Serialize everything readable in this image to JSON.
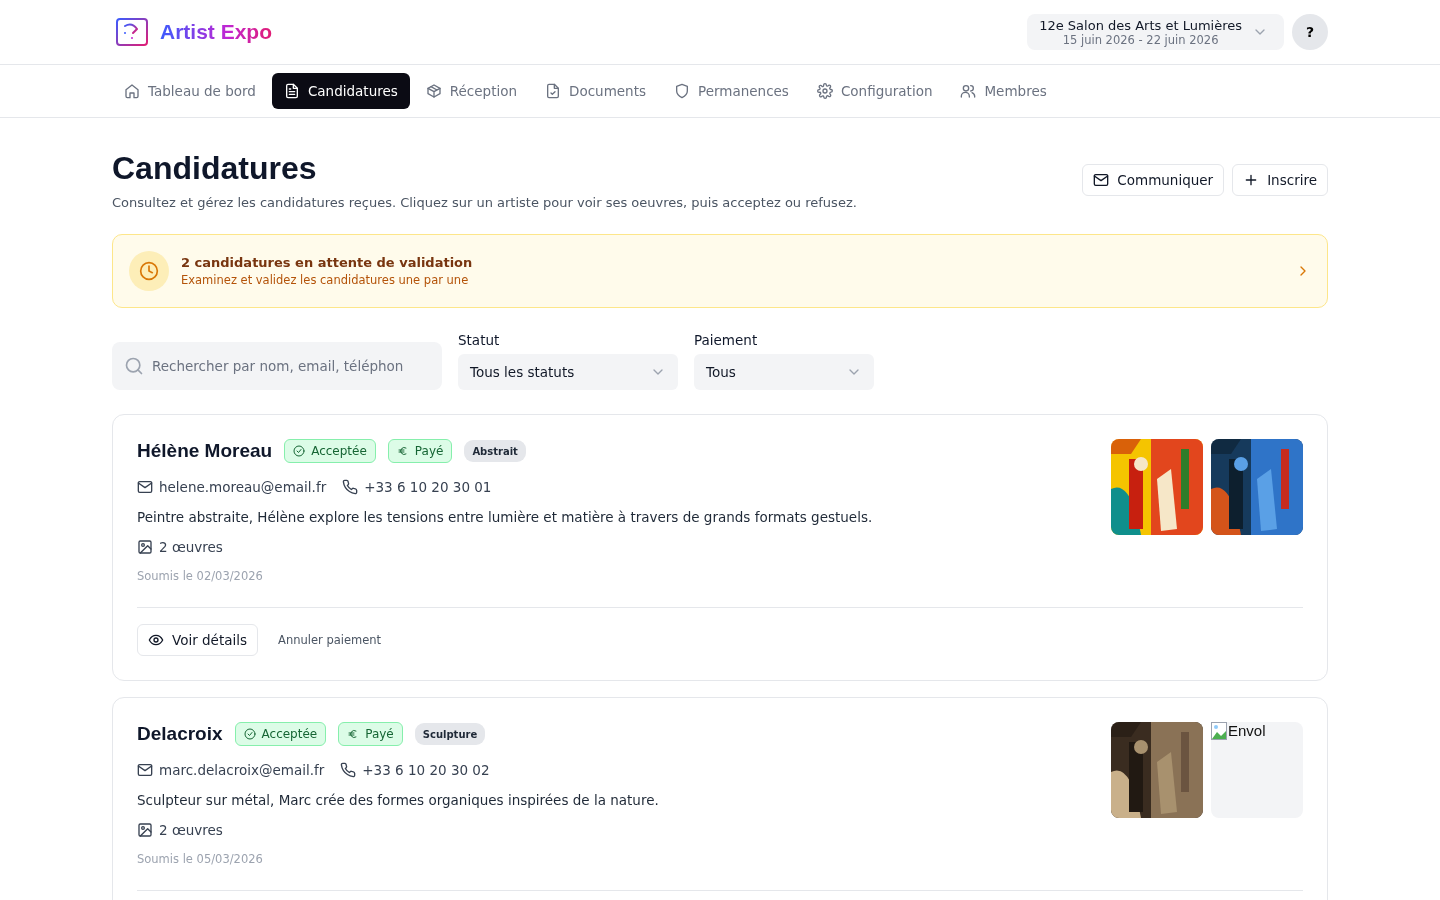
{
  "header": {
    "logo_text": "Artist Expo",
    "event": {
      "title": "12e Salon des Arts et Lumières",
      "dates": "15 juin 2026 - 22 juin 2026"
    },
    "help": "?"
  },
  "nav": [
    {
      "label": "Tableau de bord",
      "selected": false
    },
    {
      "label": "Candidatures",
      "selected": true
    },
    {
      "label": "Réception",
      "selected": false
    },
    {
      "label": "Documents",
      "selected": false
    },
    {
      "label": "Permanences",
      "selected": false
    },
    {
      "label": "Configuration",
      "selected": false
    },
    {
      "label": "Membres",
      "selected": false
    }
  ],
  "page": {
    "title": "Candidatures",
    "subtitle": "Consultez et gérez les candidatures reçues. Cliquez sur un artiste pour voir ses oeuvres, puis acceptez ou refusez.",
    "actions": [
      "Communiquer",
      "Inscrire"
    ]
  },
  "banner": {
    "title": "2 candidatures en attente de validation",
    "text": "Examinez et validez les candidatures une par une"
  },
  "filters": {
    "search": {
      "placeholder": "Rechercher par nom, email, téléphon"
    },
    "status": {
      "label": "Statut",
      "value": "Tous les statuts"
    },
    "payment": {
      "label": "Paiement",
      "value": "Tous"
    }
  },
  "applications": [
    {
      "name": "Hélène Moreau",
      "badges": [
        {
          "kind": "status",
          "label": "Acceptée"
        },
        {
          "kind": "payment",
          "label": "Payé"
        },
        {
          "kind": "category",
          "label": "Abstrait"
        }
      ],
      "email": "helene.moreau@email.fr",
      "phone": "+33 6 10 20 30 01",
      "bio": "Peintre abstraite, Hélène explore les tensions entre lumière et matière à travers de grands formats gestuels.",
      "works": "2 œuvres",
      "submitted": "Soumis le 02/03/2026",
      "artworks": [
        {
          "kind": "picture"
        },
        {
          "kind": "picture"
        }
      ],
      "actions": {
        "details": "Voir détails",
        "cancel": "Annuler paiement"
      }
    },
    {
      "name": "Delacroix",
      "badges": [
        {
          "kind": "status",
          "label": "Acceptée"
        },
        {
          "kind": "payment",
          "label": "Payé"
        },
        {
          "kind": "category",
          "label": "Sculpture"
        }
      ],
      "email": "marc.delacroix@email.fr",
      "phone": "+33 6 10 20 30 02",
      "bio": "Sculpteur sur métal, Marc crée des formes organiques inspirées de la nature.",
      "works": "2 œuvres",
      "submitted": "Soumis le 05/03/2026",
      "artworks": [
        {
          "kind": "picture"
        },
        {
          "kind": "broken",
          "alt": "Envol"
        }
      ]
    }
  ]
}
